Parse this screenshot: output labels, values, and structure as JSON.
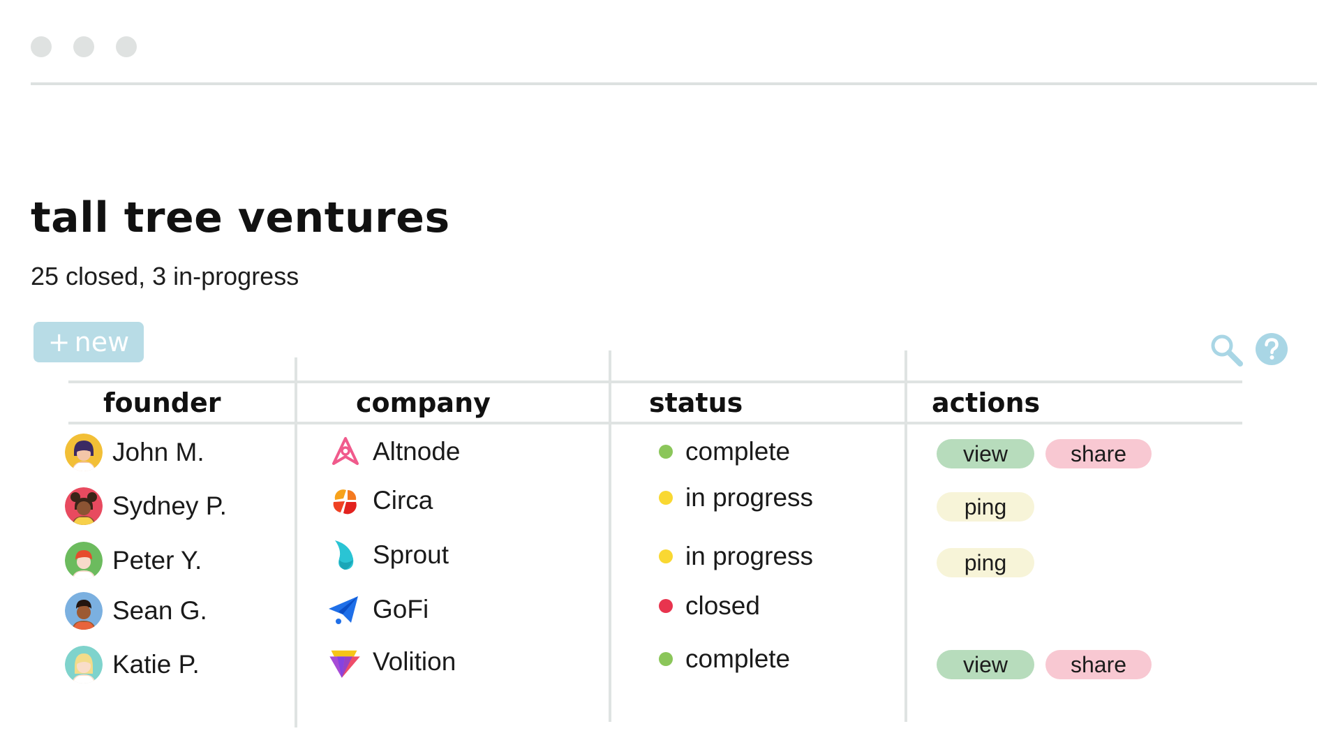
{
  "page": {
    "title": "tall tree ventures",
    "subtitle": "25 closed, 3 in-progress"
  },
  "toolbar": {
    "new_plus": "+",
    "new_label": "new",
    "search_icon": "search-icon",
    "help_icon": "help-icon"
  },
  "table": {
    "headers": [
      "founder",
      "company",
      "status",
      "actions"
    ],
    "rows": [
      {
        "founder": "John M.",
        "company": "Altnode",
        "status": "complete",
        "actions": [
          "view",
          "share"
        ]
      },
      {
        "founder": "Sydney P.",
        "company": "Circa",
        "status": "in progress",
        "actions": [
          "ping"
        ]
      },
      {
        "founder": "Peter Y.",
        "company": "Sprout",
        "status": "in progress",
        "actions": [
          "ping"
        ]
      },
      {
        "founder": "Sean G.",
        "company": "GoFi",
        "status": "closed",
        "actions": []
      },
      {
        "founder": "Katie P.",
        "company": "Volition",
        "status": "complete",
        "actions": [
          "view",
          "share"
        ]
      }
    ]
  },
  "colors": {
    "new_button_bg": "#b8dce6",
    "icon_accent": "#a9d6e5",
    "status_complete": "#8bc65a",
    "status_in_progress": "#f9d832",
    "status_closed": "#e8344e",
    "pill_view": "#b7dcbc",
    "pill_share": "#f8c8d2",
    "pill_ping": "#f7f4d8",
    "rule": "#dfe3e2"
  }
}
